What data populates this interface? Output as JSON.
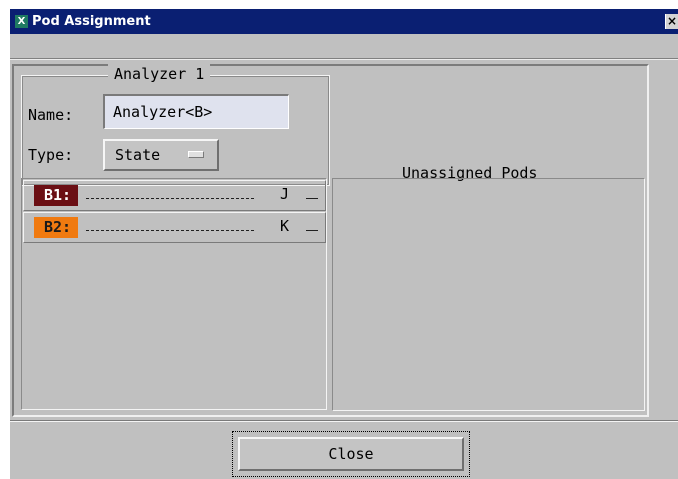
{
  "window": {
    "title": "Pod Assignment",
    "icon_letter": "X",
    "close_glyph": "×"
  },
  "analyzer": {
    "frame_title": "Analyzer 1",
    "name_label": "Name:",
    "name_value": "Analyzer<B>",
    "type_label": "Type:",
    "type_value": "State"
  },
  "assigned_pods": [
    {
      "label": "B1:",
      "clock": "J",
      "color": "#6b0f14",
      "text_color": "#ffffff"
    },
    {
      "label": "B2:",
      "clock": "K",
      "color": "#f07a10",
      "text_color": "#1a1a1a"
    }
  ],
  "unassigned": {
    "heading": "Unassigned Pods"
  },
  "buttons": {
    "close_label": "Close"
  }
}
